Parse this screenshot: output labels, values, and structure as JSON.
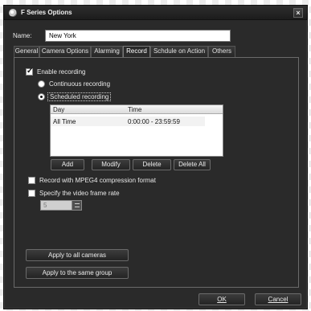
{
  "window": {
    "title": "F Series Options",
    "close_label": "×"
  },
  "name_field": {
    "label": "Name:",
    "value": "New York"
  },
  "tabs": [
    {
      "label": "General"
    },
    {
      "label": "Camera Options"
    },
    {
      "label": "Alarming"
    },
    {
      "label": "Record",
      "active": true
    },
    {
      "label": "Schdule on Action"
    },
    {
      "label": "Others"
    }
  ],
  "record": {
    "enable_label": "Enable recording",
    "enable_checked": true,
    "continuous_label": "Continuous recording",
    "continuous_selected": false,
    "scheduled_label": "Scheduled recording",
    "scheduled_selected": true
  },
  "schedule_table": {
    "columns": [
      "Day",
      "Time"
    ],
    "rows": [
      {
        "day": "All Time",
        "time": "0:00:00 - 23:59:59"
      }
    ]
  },
  "schedule_buttons": {
    "add": "Add",
    "modify": "Modify",
    "delete": "Delete",
    "delete_all": "Delete All"
  },
  "mpeg4": {
    "label": "Record with MPEG4 compression format",
    "checked": false
  },
  "frame_rate": {
    "label": "Specify the video frame rate",
    "checked": false,
    "value": "5"
  },
  "apply": {
    "all_cameras": "Apply to all cameras",
    "same_group": "Apply to the same group"
  },
  "dialog": {
    "ok": "OK",
    "cancel": "Cancel"
  }
}
